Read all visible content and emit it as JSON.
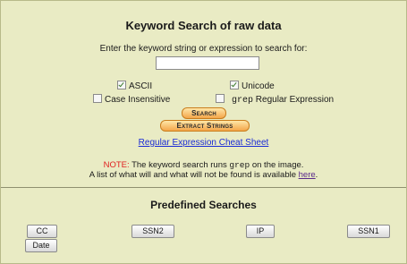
{
  "search": {
    "title": "Keyword Search of raw data",
    "prompt": "Enter the keyword string or expression to search for:",
    "input_value": ""
  },
  "options": {
    "ascii": {
      "label": "ASCII",
      "checked": true
    },
    "unicode": {
      "label": "Unicode",
      "checked": true
    },
    "case_insensitive": {
      "label": "Case Insensitive",
      "checked": false
    },
    "grep": {
      "label_mono": "grep",
      "label_rest": "Regular Expression",
      "checked": false
    }
  },
  "buttons": {
    "search": "Search",
    "extract": "Extract Strings"
  },
  "cheat_sheet_link": "Regular Expression Cheat Sheet",
  "note": {
    "label": "NOTE:",
    "text1": "The keyword search runs",
    "cmd": "grep",
    "text2": "on the image.",
    "line2": "A list of what will and what will not be found is available",
    "link": "here",
    "period": "."
  },
  "predefined": {
    "title": "Predefined Searches",
    "items": [
      "CC",
      "SSN2",
      "IP",
      "SSN1",
      "Date"
    ]
  }
}
